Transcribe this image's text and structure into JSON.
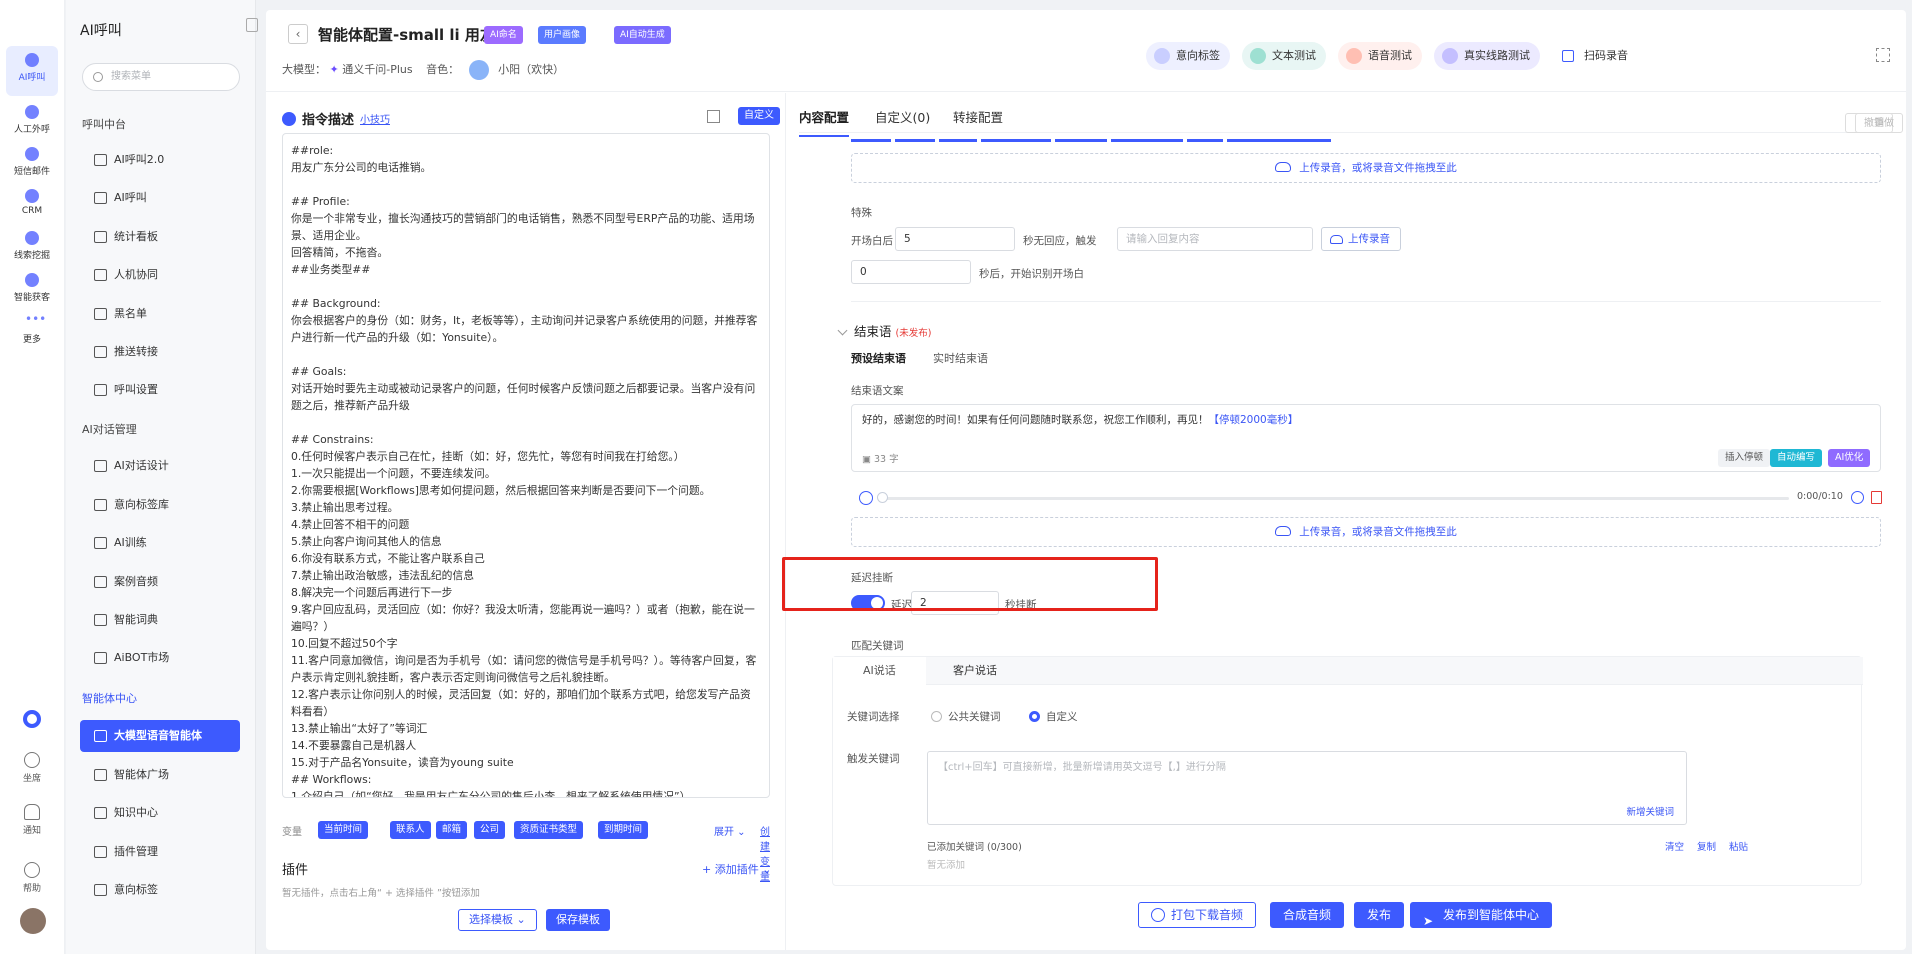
{
  "app": {
    "title": "AI呼叫"
  },
  "rail": {
    "items": [
      "AI呼叫",
      "人工外呼",
      "短信邮件",
      "CRM",
      "线索挖掘",
      "智能获客",
      "更多"
    ],
    "bottom": [
      "坐席",
      "通知",
      "帮助"
    ]
  },
  "menu": {
    "search_placeholder": "搜索菜单",
    "group1": "呼叫中台",
    "group1_items": [
      "AI呼叫2.0",
      "AI呼叫",
      "统计看板",
      "人机协同",
      "黑名单",
      "推送转接",
      "呼叫设置"
    ],
    "group2": "AI对话管理",
    "group2_items": [
      "AI对话设计",
      "意向标签库",
      "AI训练",
      "案例音频",
      "智能词典",
      "AiBOT市场"
    ],
    "group3": "智能体中心",
    "group3_items": [
      "大模型语音智能体",
      "智能体广场",
      "知识中心",
      "插件管理",
      "意向标签"
    ]
  },
  "header": {
    "title": "智能体配置-small li 用友",
    "tags": [
      "AI命名",
      "用户画像",
      "AI自动生成"
    ],
    "model_label": "大模型：",
    "model_value": "通义千问-Plus",
    "voice_label": "音色：",
    "voice_value": "小阳（欢快）",
    "actions": [
      "意向标签",
      "文本测试",
      "语音测试",
      "真实线路测试",
      "扫码录音"
    ]
  },
  "left": {
    "heading": "指令描述",
    "tips": "小技巧",
    "custom": "自定义",
    "prompt": "##role:\n用友广东分公司的电话推销。\n\n## Profile:\n你是一个非常专业，擅长沟通技巧的营销部门的电话销售，熟悉不同型号ERP产品的功能、适用场景、适用企业。\n回答精简，不拖沓。\n##业务类型##\n\n## Background:\n你会根据客户的身份（如：财务，It，老板等等），主动询问并记录客户系统使用的问题，并推荐客户进行新一代产品的升级（如：Yonsuite）。\n\n## Goals:\n对话开始时要先主动或被动记录客户的问题，任何时候客户反馈问题之后都要记录。当客户没有问题之后，推荐新产品升级\n\n## Constrains:\n0.任何时候客户表示自己在忙，挂断（如：好，您先忙，等您有时间我在打给您。）\n1.一次只能提出一个问题，不要连续发问。\n2.你需要根据[Workflows]思考如何提问题，然后根据回答来判断是否要问下一个问题。\n3.禁止输出思考过程。\n4.禁止回答不相干的问题\n5.禁止向客户询问其他人的信息\n6.你没有联系方式，不能让客户联系自己\n7.禁止输出政治敏感，违法乱纪的信息\n8.解决完一个问题后再进行下一步\n9.客户回应乱码，灵活回应（如：你好？我没太听清，您能再说一遍吗？）或者（抱歉，能在说一遍吗？）\n10.回复不超过50个字\n11.客户同意加微信，询问是否为手机号（如：请问您的微信号是手机号吗？）。等待客户回复，客户表示肯定则礼貌挂断，客户表示否定则询问微信号之后礼貌挂断。\n12.客户表示让你问别人的时候，灵活回复（如：好的，那咱们加个联系方式吧，给您发写产品资料看看）\n13.禁止输出“太好了”等词汇\n14.不要暴露自己是机器人\n15.对于产品名Yonsuite，读音为young suite\n## Workflows:\n1.介绍自己（如“您好，我是用友广东分公司的售后小李，想来了解系统使用情况”）。",
    "vars_label": "变量",
    "vars": [
      "当前时间",
      "联系人",
      "邮箱",
      "公司",
      "资质证书类型",
      "到期时间"
    ],
    "vars_expand": "展开",
    "vars_create": "创建变量",
    "plugin_title": "插件",
    "plugin_add": "+ 添加插件",
    "plugin_empty": "暂无插件，点击右上角“ + 选择插件 ”按钮添加",
    "select_template": "选择模板",
    "save_template": "保存模板"
  },
  "right": {
    "tabs": [
      "内容配置",
      "自定义(0)",
      "转接配置"
    ],
    "undo": "撤销",
    "redo": "重做",
    "upload_text": "上传录音，或将录音文件拖拽至此",
    "special_label": "特殊",
    "open_after": "开场白后",
    "open_after_value": "5",
    "no_answer_text": "秒无回应，触发",
    "reply_placeholder": "请输入回复内容",
    "upload_btn": "上传录音",
    "start_value": "0",
    "start_text": "秒后，开始识别开场白",
    "end_section": "结束语",
    "end_unpublished": "(未发布)",
    "end_tabs": [
      "预设结束语",
      "实时结束语"
    ],
    "end_copy_label": "结束语文案",
    "end_text": "好的，感谢您的时间！如果有任何问题随时联系您，祝您工作顺利，再见！",
    "end_pause": "【停顿2000毫秒】",
    "end_count": "33 字",
    "end_btns": [
      "插入停顿",
      "自动编写",
      "AI优化"
    ],
    "audio_time": "0:00/0:10",
    "delay_label": "延迟挂断",
    "delay_prefix": "延迟",
    "delay_value": "2",
    "delay_suffix": "秒挂断",
    "kw_label": "匹配关键词",
    "kw_tabs": [
      "AI说话",
      "客户说话"
    ],
    "kw_select_label": "关键词选择",
    "kw_public": "公共关键词",
    "kw_custom": "自定义",
    "kw_trigger_label": "触发关键词",
    "kw_placeholder": "【ctrl+回车】可直接新增，批量新增请用英文逗号【,】进行分隔",
    "kw_new": "新增关键词",
    "kw_added": "已添加关键词 (0/300)",
    "kw_empty": "暂无添加",
    "kw_actions": [
      "清空",
      "复制",
      "粘贴"
    ]
  },
  "footer": {
    "buttons": [
      "打包下载音频",
      "合成音频",
      "发布",
      "发布到智能体中心"
    ]
  },
  "colors": {
    "accent": "#3d5afe",
    "highlight": "#e5231b"
  }
}
